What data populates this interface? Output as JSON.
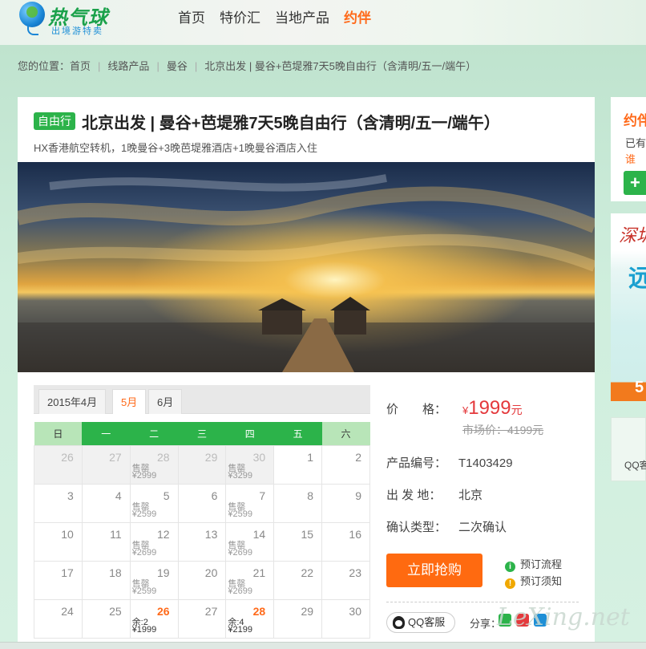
{
  "header": {
    "logo_title": "热气球",
    "logo_subtitle": "出境游特卖",
    "nav": [
      "首页",
      "特价汇",
      "当地产品",
      "约伴"
    ]
  },
  "breadcrumb": {
    "prefix": "您的位置：",
    "items": [
      "首页",
      "线路产品",
      "曼谷",
      "北京出发 | 曼谷+芭堤雅7天5晚自由行（含清明/五一/端午）"
    ]
  },
  "product": {
    "tag": "自由行",
    "title": "北京出发 | 曼谷+芭堤雅7天5晚自由行（含清明/五一/端午）",
    "subtitle": "HX香港航空转机，1晚曼谷+3晚芭堤雅酒店+1晚曼谷酒店入住"
  },
  "calendar": {
    "tabs": [
      "2015年4月",
      "5月",
      "6月"
    ],
    "active_tab": 1,
    "weekdays": [
      "日",
      "一",
      "二",
      "三",
      "四",
      "五",
      "六"
    ],
    "weeks": [
      [
        {
          "d": "26",
          "g": true
        },
        {
          "d": "27",
          "g": true
        },
        {
          "d": "28",
          "g": true,
          "s1": "售罄",
          "s2": "¥2999"
        },
        {
          "d": "29",
          "g": true
        },
        {
          "d": "30",
          "g": true,
          "s1": "售罄",
          "s2": "¥3299"
        },
        {
          "d": "1"
        },
        {
          "d": "2"
        }
      ],
      [
        {
          "d": "3"
        },
        {
          "d": "4"
        },
        {
          "d": "5",
          "s1": "售罄",
          "s2": "¥2599"
        },
        {
          "d": "6"
        },
        {
          "d": "7",
          "s1": "售罄",
          "s2": "¥2599"
        },
        {
          "d": "8"
        },
        {
          "d": "9"
        }
      ],
      [
        {
          "d": "10"
        },
        {
          "d": "11"
        },
        {
          "d": "12",
          "s1": "售罄",
          "s2": "¥2699"
        },
        {
          "d": "13"
        },
        {
          "d": "14",
          "s1": "售罄",
          "s2": "¥2699"
        },
        {
          "d": "15"
        },
        {
          "d": "16"
        }
      ],
      [
        {
          "d": "17"
        },
        {
          "d": "18"
        },
        {
          "d": "19",
          "s1": "售罄",
          "s2": "¥2599"
        },
        {
          "d": "20"
        },
        {
          "d": "21",
          "s1": "售罄",
          "s2": "¥2699"
        },
        {
          "d": "22"
        },
        {
          "d": "23"
        }
      ],
      [
        {
          "d": "24"
        },
        {
          "d": "25"
        },
        {
          "d": "26",
          "h": true,
          "s1": "余:2",
          "s2": "¥1999"
        },
        {
          "d": "27"
        },
        {
          "d": "28",
          "h": true,
          "s1": "余:4",
          "s2": "¥2199"
        },
        {
          "d": "29"
        },
        {
          "d": "30"
        }
      ]
    ]
  },
  "info": {
    "price_label": "价　　格：",
    "price_currency": "¥",
    "price_value": "1999",
    "price_unit": "元",
    "market_label": "市场价：",
    "market_value": "4199元",
    "code_label": "产品编号：",
    "code_value": "T1403429",
    "from_label": "出 发 地：",
    "from_value": "北京",
    "confirm_label": "确认类型：",
    "confirm_value": "二次确认",
    "buy_label": "立即抢购",
    "flow_label": "预订流程",
    "notice_label": "预订须知",
    "qq_label": "QQ客服",
    "share_label": "分享："
  },
  "sidebar": {
    "box1_title": "约伴",
    "box1_line1": "已有",
    "box1_line2": "谁",
    "box2_title": "深圳",
    "box2_big": "远",
    "box2_bottom": "5",
    "box3_label": "QQ客"
  },
  "watermark": "LeXing.net",
  "colors": {
    "brand_green": "#2cb34a",
    "accent_orange": "#ff6a10",
    "price_red": "#e4393c"
  }
}
